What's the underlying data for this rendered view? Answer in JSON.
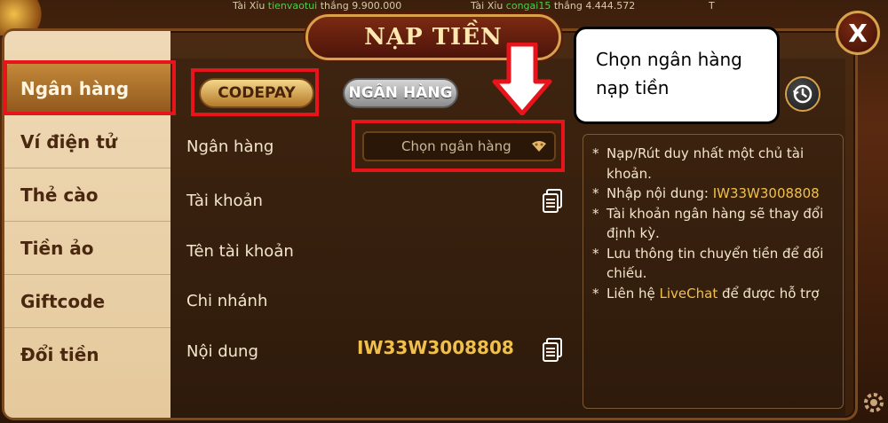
{
  "ticker": [
    {
      "prefix": "Tài Xỉu",
      "user": "tienvaotui",
      "action": "thắng",
      "amount": "9.900.000"
    },
    {
      "prefix": "Tài Xỉu",
      "user": "congai15",
      "action": "thắng",
      "amount": "4.444.572"
    },
    {
      "prefix": "T",
      "user": "",
      "action": "",
      "amount": ""
    }
  ],
  "title": "NẠP TIỀN",
  "close_label": "X",
  "sidebar": {
    "items": [
      {
        "label": "Ngân hàng",
        "active": true
      },
      {
        "label": "Ví điện tử",
        "active": false
      },
      {
        "label": "Thẻ cào",
        "active": false
      },
      {
        "label": "Tiền ảo",
        "active": false
      },
      {
        "label": "Giftcode",
        "active": false
      },
      {
        "label": "Đổi tiền",
        "active": false
      }
    ]
  },
  "tabs": {
    "codepay": "CODEPAY",
    "bank": "NGÂN HÀNG"
  },
  "form": {
    "bank_label": "Ngân hàng",
    "bank_select_placeholder": "Chọn ngân hàng",
    "account_label": "Tài khoản",
    "account_name_label": "Tên tài khoản",
    "branch_label": "Chi nhánh",
    "content_label": "Nội dung",
    "content_value": "IW33W3008808"
  },
  "notes": {
    "bullet": "*",
    "n1": "Nạp/Rút duy nhất một chủ tài khoản.",
    "n2_prefix": "Nhập nội dung: ",
    "n2_code": "IW33W3008808",
    "n3": "Tài khoản ngân hàng sẽ thay đổi định kỳ.",
    "n4": "Lưu thông tin chuyển tiền để đối chiếu.",
    "n5_prefix": "Liên hệ ",
    "n5_link": "LiveChat",
    "n5_suffix": " để được hỗ trợ"
  },
  "callout": {
    "line1": "Chọn ngân hàng",
    "line2": "nạp tiền"
  },
  "colors": {
    "accent": "#f0c04c",
    "highlight_red": "#e8141c",
    "panel_dark": "#3e2410",
    "sidebar_light": "#efd9b6"
  },
  "icons": {
    "close": "close-icon",
    "history": "history-icon",
    "copy": "copy-icon",
    "dropdown": "dropdown-icon",
    "arrow": "down-arrow-icon",
    "settings": "gear-icon"
  }
}
